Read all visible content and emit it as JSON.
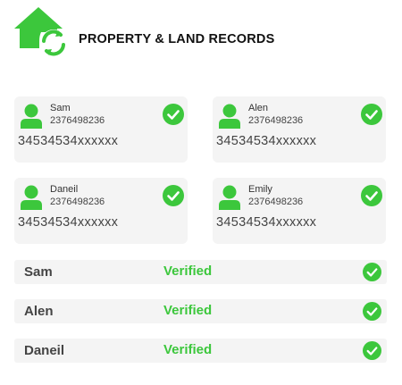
{
  "colors": {
    "accent_green": "#3cc73c",
    "card_bg": "#f4f4f4"
  },
  "header": {
    "title": "PROPERTY & LAND RECORDS",
    "logo_icon": "house-sync-icon"
  },
  "cards": [
    {
      "name": "Sam",
      "phone": "2376498236",
      "number": "34534534xxxxxx",
      "verified": true
    },
    {
      "name": "Alen",
      "phone": "2376498236",
      "number": "34534534xxxxxx",
      "verified": true
    },
    {
      "name": "Daneil",
      "phone": "2376498236",
      "number": "34534534xxxxxx",
      "verified": true
    },
    {
      "name": "Emily",
      "phone": "2376498236",
      "number": "34534534xxxxxx",
      "verified": true
    }
  ],
  "rows": [
    {
      "name": "Sam",
      "status": "Verified"
    },
    {
      "name": "Alen",
      "status": "Verified"
    },
    {
      "name": "Daneil",
      "status": "Verified"
    }
  ]
}
